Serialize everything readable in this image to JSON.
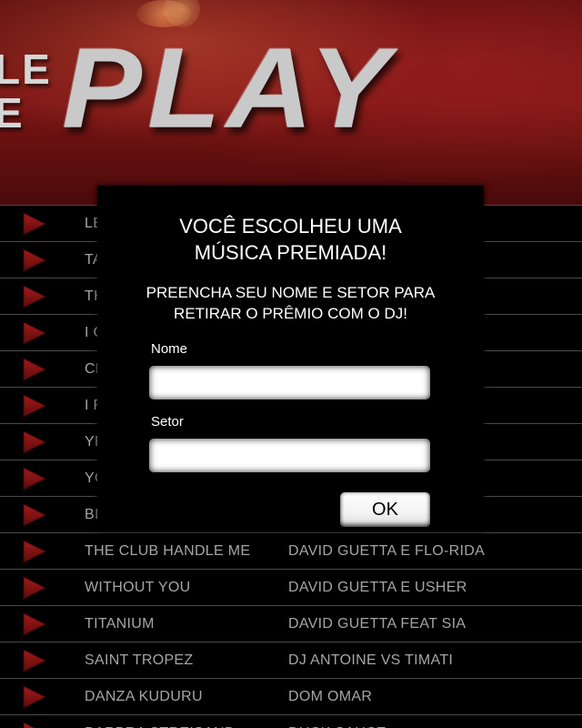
{
  "banner": {
    "logo_small_line1": "LE",
    "logo_small_line2": "E",
    "logo_main": "PLAY"
  },
  "songs": [
    {
      "title": "LE",
      "artist": ""
    },
    {
      "title": "TA",
      "artist": ""
    },
    {
      "title": "TH",
      "artist": ""
    },
    {
      "title": "I G",
      "artist": ""
    },
    {
      "title": "CL",
      "artist": ""
    },
    {
      "title": "I F",
      "artist": ""
    },
    {
      "title": "YE",
      "artist": ""
    },
    {
      "title": "YO",
      "artist": ""
    },
    {
      "title": "BI",
      "artist": ""
    },
    {
      "title": "THE CLUB HANDLE ME",
      "artist": "DAVID GUETTA E FLO-RIDA"
    },
    {
      "title": "WITHOUT YOU",
      "artist": "DAVID GUETTA E USHER"
    },
    {
      "title": "TITANIUM",
      "artist": "DAVID GUETTA FEAT SIA"
    },
    {
      "title": "SAINT TROPEZ",
      "artist": "DJ ANTOINE VS TIMATI"
    },
    {
      "title": "DANZA KUDURU",
      "artist": "DOM OMAR"
    },
    {
      "title": "BARBRA STREISAND",
      "artist": "DUCK SAUCE"
    }
  ],
  "modal": {
    "title_line1": "VOCÊ ESCOLHEU UMA",
    "title_line2": "MÚSICA PREMIADA!",
    "subtitle_line1": "PREENCHA SEU NOME E SETOR PARA",
    "subtitle_line2": "RETIRAR O PRÊMIO COM O DJ!",
    "name_label": "Nome",
    "name_value": "",
    "sector_label": "Setor",
    "sector_value": "",
    "ok_label": "OK"
  },
  "colors": {
    "banner_red": "#7a1414",
    "play_icon": "#8a1212",
    "row_text": "#a5a5a5",
    "row_divider": "#4a4a4a"
  },
  "icons": {
    "row_icon": "play-icon"
  }
}
